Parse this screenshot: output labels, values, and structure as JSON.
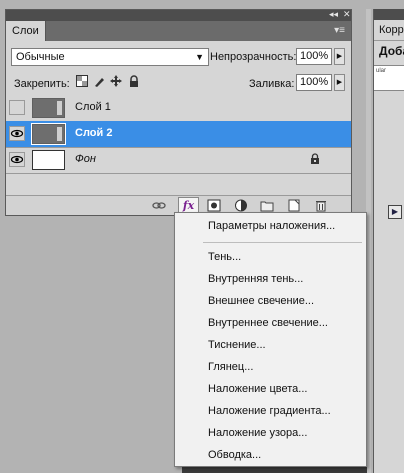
{
  "layers_panel": {
    "tab_label": "Слои",
    "blend_mode": "Обычные",
    "opacity_label": "Непрозрачность:",
    "opacity_value": "100%",
    "lock_label": "Закрепить:",
    "fill_label": "Заливка:",
    "fill_value": "100%",
    "layers": [
      {
        "name": "Слой 1",
        "visible": false,
        "selected": false
      },
      {
        "name": "Слой 2",
        "visible": true,
        "selected": true
      },
      {
        "name": "Фон",
        "visible": true,
        "selected": false,
        "locked": true
      }
    ],
    "fx_label": "fx"
  },
  "right_panel": {
    "tab_label": "Корр",
    "subtitle": "Доба",
    "box_text": "ular"
  },
  "effects_menu": {
    "items": [
      "Параметры наложения...",
      "Тень...",
      "Внутренняя тень...",
      "Внешнее свечение...",
      "Внутреннее свечение...",
      "Тиснение...",
      "Глянец...",
      "Наложение цвета...",
      "Наложение градиента...",
      "Наложение узора...",
      "Обводка..."
    ]
  },
  "colors": {
    "selection": "#3a8ee6",
    "panel_bg": "#d6d6d6",
    "menu_bg": "#f1f1f1"
  }
}
